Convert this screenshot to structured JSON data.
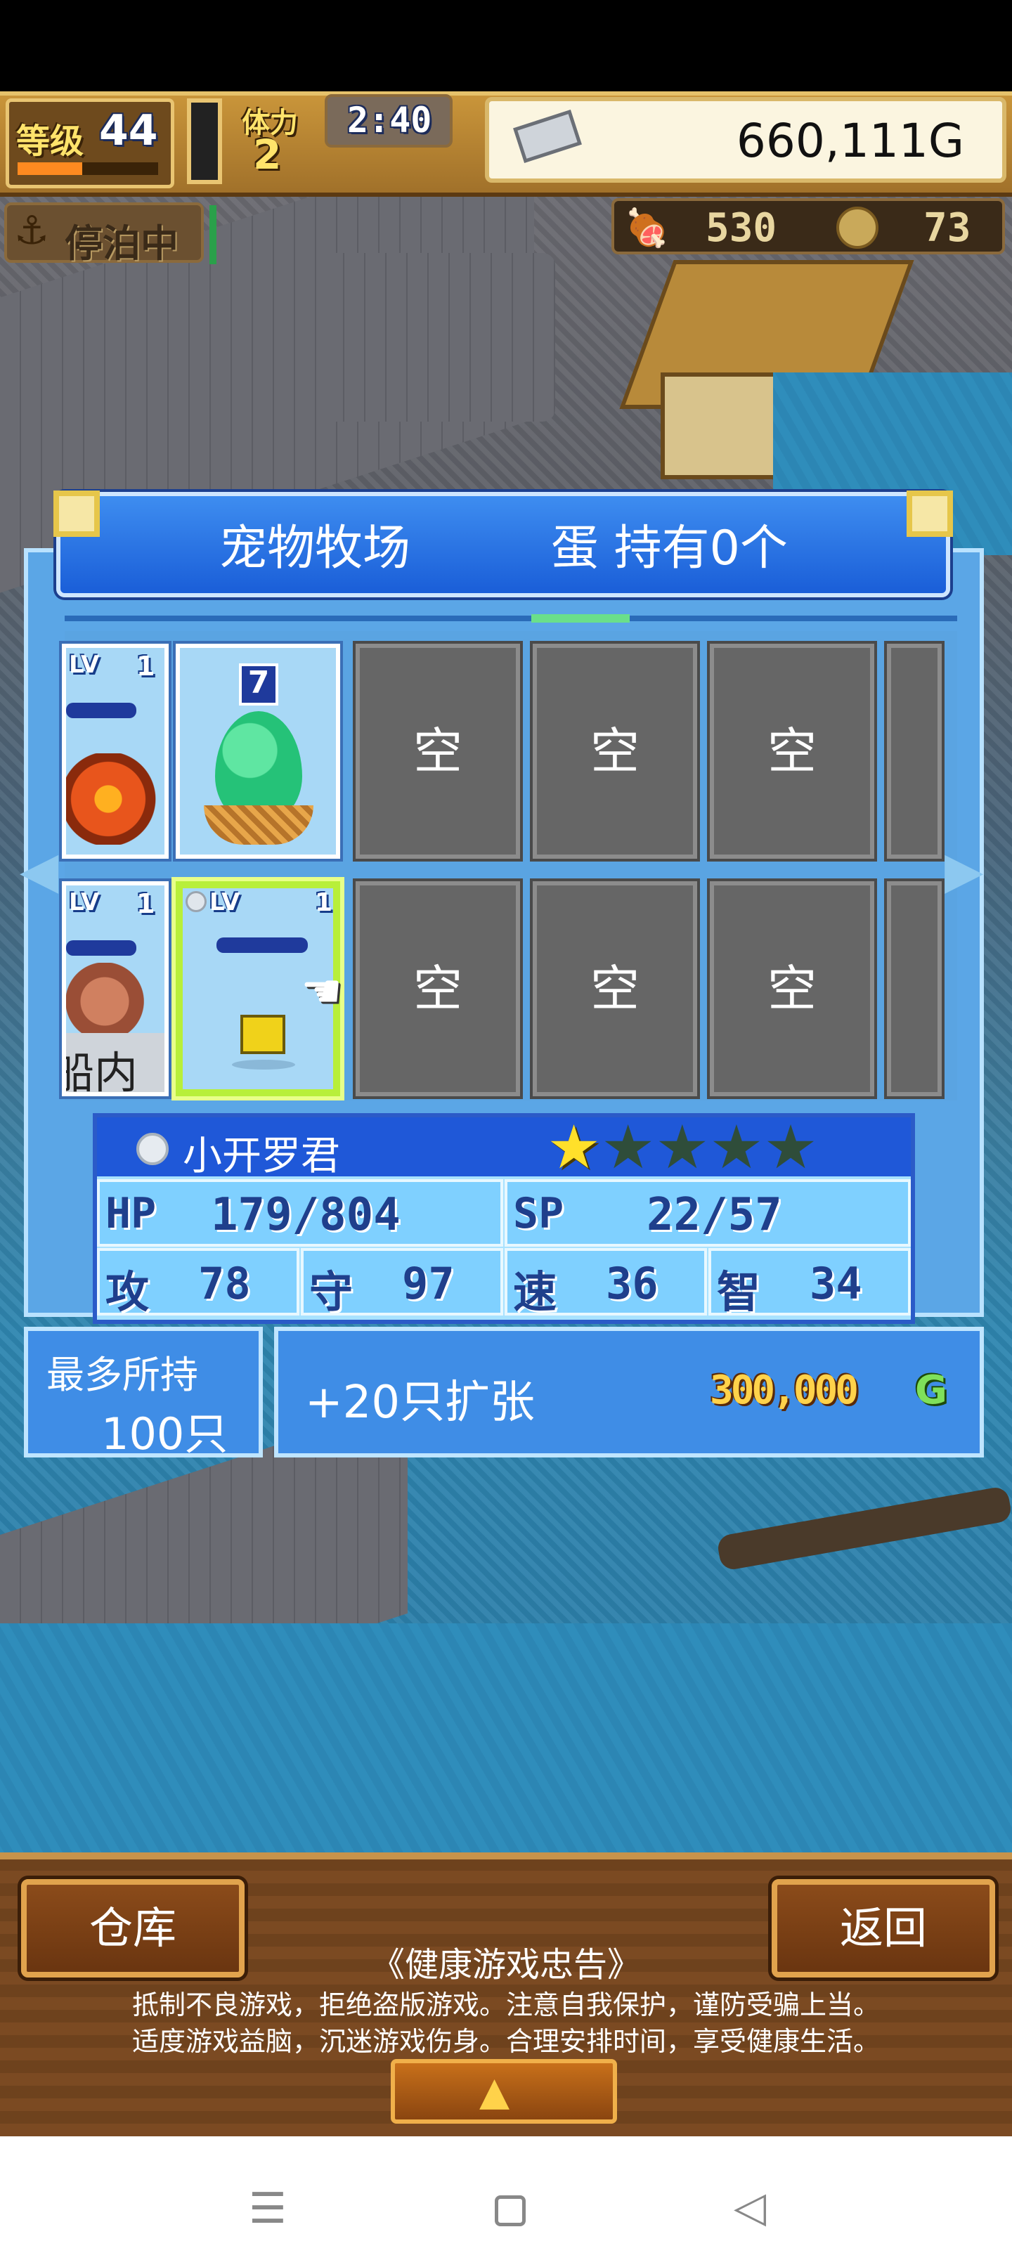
{
  "hud": {
    "level_label": "等级",
    "level_value": "44",
    "day_label": "体力",
    "day_value": "2",
    "time": "2:40",
    "gold": "660,111G",
    "status": "停泊中",
    "food": "530",
    "medal": "73"
  },
  "ranch": {
    "title": "宠物牧场",
    "egg_status": "蛋 持有0个",
    "row1": [
      {
        "type": "pet",
        "level_label": "LV",
        "level": "1"
      },
      {
        "type": "egg",
        "number": "7"
      },
      {
        "type": "empty",
        "label": "空"
      },
      {
        "type": "empty",
        "label": "空"
      },
      {
        "type": "empty",
        "label": "空"
      }
    ],
    "row2": [
      {
        "type": "pet",
        "level_label": "LV",
        "level": "1",
        "tag": "船内"
      },
      {
        "type": "pet-selected",
        "level_label": "LV",
        "level": "1"
      },
      {
        "type": "empty",
        "label": "空"
      },
      {
        "type": "empty",
        "label": "空"
      },
      {
        "type": "empty",
        "label": "空"
      }
    ]
  },
  "selected_pet": {
    "name": "小开罗君",
    "stars_total": 5,
    "stars_filled": 1,
    "hp_label": "HP",
    "hp": "179/804",
    "sp_label": "SP",
    "sp": "22/57",
    "atk_label": "攻",
    "atk": "78",
    "def_label": "守",
    "def": "97",
    "spd_label": "速",
    "spd": "36",
    "int_label": "智",
    "int": "34"
  },
  "capacity": {
    "label": "最多所持",
    "value": "100只"
  },
  "expand": {
    "label": "+20只扩张",
    "price": "300,000",
    "currency": "G"
  },
  "footer": {
    "warehouse_button": "仓库",
    "back_button": "返回",
    "notice_title": "《健康游戏忠告》",
    "notice_line1": "抵制不良游戏，拒绝盗版游戏。注意自我保护，谨防受骗上当。",
    "notice_line2": "适度游戏益脑，沉迷游戏伤身。合理安排时间，享受健康生活。"
  },
  "colors": {
    "panel_blue": "#3f8de6",
    "gold": "#ffe36b",
    "star_filled": "#ffe02a",
    "star_empty": "#2f4d3a"
  }
}
